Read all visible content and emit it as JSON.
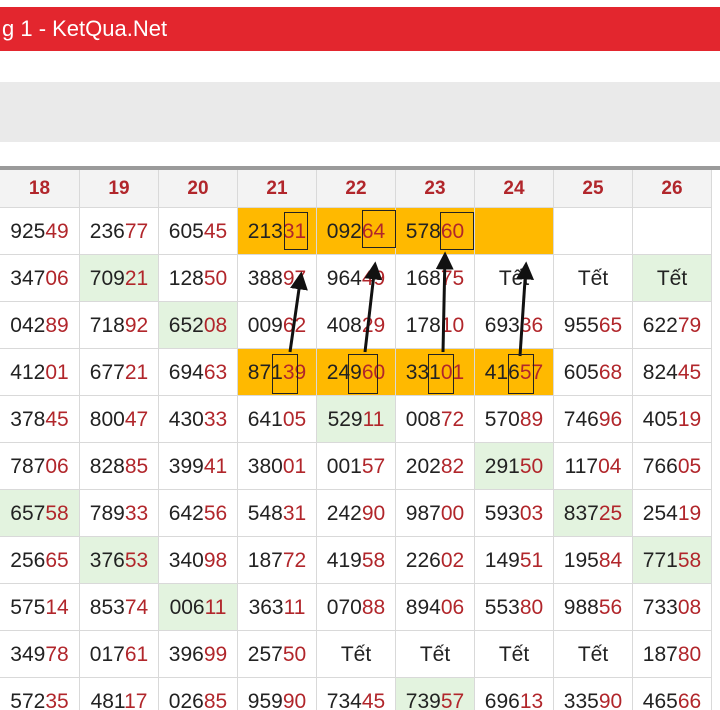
{
  "window": {
    "title": "g 1 - KetQua.Net"
  },
  "table": {
    "headers": [
      "18",
      "19",
      "20",
      "21",
      "22",
      "23",
      "24",
      "25",
      "26"
    ],
    "rows": [
      [
        [
          "925",
          "49"
        ],
        [
          "236",
          "77"
        ],
        [
          "605",
          "45"
        ],
        [
          "213",
          "31"
        ],
        [
          "092",
          "64"
        ],
        [
          "578",
          "60"
        ],
        [
          "",
          ""
        ],
        [
          "",
          ""
        ],
        [
          "",
          ""
        ]
      ],
      [
        [
          "347",
          "06"
        ],
        [
          "709",
          "21"
        ],
        [
          "128",
          "50"
        ],
        [
          "388",
          "97"
        ],
        [
          "964",
          "49"
        ],
        [
          "168",
          "75"
        ],
        [
          "Tết",
          ""
        ],
        [
          "Tết",
          ""
        ],
        [
          "Tết",
          ""
        ]
      ],
      [
        [
          "042",
          "89"
        ],
        [
          "718",
          "92"
        ],
        [
          "652",
          "08"
        ],
        [
          "009",
          "62"
        ],
        [
          "408",
          "29"
        ],
        [
          "178",
          "10"
        ],
        [
          "693",
          "36"
        ],
        [
          "955",
          "65"
        ],
        [
          "622",
          "79"
        ]
      ],
      [
        [
          "412",
          "01"
        ],
        [
          "677",
          "21"
        ],
        [
          "694",
          "63"
        ],
        [
          "871",
          "39"
        ],
        [
          "249",
          "60"
        ],
        [
          "331",
          "01"
        ],
        [
          "416",
          "57"
        ],
        [
          "605",
          "68"
        ],
        [
          "824",
          "45"
        ]
      ],
      [
        [
          "378",
          "45"
        ],
        [
          "800",
          "47"
        ],
        [
          "430",
          "33"
        ],
        [
          "641",
          "05"
        ],
        [
          "529",
          "11"
        ],
        [
          "008",
          "72"
        ],
        [
          "570",
          "89"
        ],
        [
          "746",
          "96"
        ],
        [
          "405",
          "19"
        ]
      ],
      [
        [
          "787",
          "06"
        ],
        [
          "828",
          "85"
        ],
        [
          "399",
          "41"
        ],
        [
          "380",
          "01"
        ],
        [
          "001",
          "57"
        ],
        [
          "202",
          "82"
        ],
        [
          "291",
          "50"
        ],
        [
          "117",
          "04"
        ],
        [
          "766",
          "05"
        ]
      ],
      [
        [
          "657",
          "58"
        ],
        [
          "789",
          "33"
        ],
        [
          "642",
          "56"
        ],
        [
          "548",
          "31"
        ],
        [
          "242",
          "90"
        ],
        [
          "987",
          "00"
        ],
        [
          "593",
          "03"
        ],
        [
          "837",
          "25"
        ],
        [
          "254",
          "19"
        ]
      ],
      [
        [
          "256",
          "65"
        ],
        [
          "376",
          "53"
        ],
        [
          "340",
          "98"
        ],
        [
          "187",
          "72"
        ],
        [
          "419",
          "58"
        ],
        [
          "226",
          "02"
        ],
        [
          "149",
          "51"
        ],
        [
          "195",
          "84"
        ],
        [
          "771",
          "58"
        ]
      ],
      [
        [
          "575",
          "14"
        ],
        [
          "853",
          "74"
        ],
        [
          "006",
          "11"
        ],
        [
          "363",
          "11"
        ],
        [
          "070",
          "88"
        ],
        [
          "894",
          "06"
        ],
        [
          "553",
          "80"
        ],
        [
          "988",
          "56"
        ],
        [
          "733",
          "08"
        ]
      ],
      [
        [
          "349",
          "78"
        ],
        [
          "017",
          "61"
        ],
        [
          "396",
          "99"
        ],
        [
          "257",
          "50"
        ],
        [
          "Tết",
          ""
        ],
        [
          "Tết",
          ""
        ],
        [
          "Tết",
          ""
        ],
        [
          "Tết",
          ""
        ],
        [
          "187",
          "80"
        ]
      ],
      [
        [
          "572",
          "35"
        ],
        [
          "481",
          "17"
        ],
        [
          "026",
          "85"
        ],
        [
          "959",
          "90"
        ],
        [
          "734",
          "45"
        ],
        [
          "739",
          "57"
        ],
        [
          "696",
          "13"
        ],
        [
          "335",
          "90"
        ],
        [
          "465",
          "66"
        ]
      ]
    ],
    "colors": {
      "accent_red": "#e3262e",
      "number_red": "#b1262b",
      "highlight_orange": "#ffb900",
      "green_bg": "#e3f3df"
    }
  }
}
